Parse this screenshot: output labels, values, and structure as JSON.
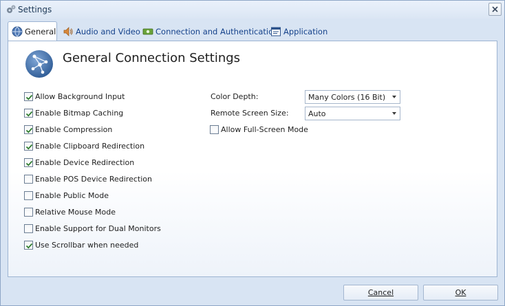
{
  "window": {
    "title": "Settings"
  },
  "tabs": [
    {
      "label": "General",
      "icon": "globe-icon",
      "active": true
    },
    {
      "label": "Audio and Video",
      "icon": "speaker-icon",
      "active": false
    },
    {
      "label": "Connection and Authentication",
      "icon": "network-icon",
      "active": false
    },
    {
      "label": "Application",
      "icon": "window-icon",
      "active": false
    }
  ],
  "panel": {
    "title": "General Connection Settings",
    "logo_icon": "network-globe-icon",
    "checkboxes": [
      {
        "label": "Allow Background Input",
        "checked": true
      },
      {
        "label": "Enable Bitmap Caching",
        "checked": true
      },
      {
        "label": "Enable Compression",
        "checked": true
      },
      {
        "label": "Enable Clipboard Redirection",
        "checked": true
      },
      {
        "label": "Enable Device Redirection",
        "checked": true
      },
      {
        "label": "Enable POS Device Redirection",
        "checked": false
      },
      {
        "label": "Enable Public Mode",
        "checked": false
      },
      {
        "label": "Relative Mouse Mode",
        "checked": false
      },
      {
        "label": "Enable Support for Dual Monitors",
        "checked": false
      },
      {
        "label": "Use Scrollbar when needed",
        "checked": true
      }
    ],
    "color_depth": {
      "label": "Color Depth:",
      "value": "Many Colors (16 Bit)"
    },
    "screen_size": {
      "label": "Remote Screen Size:",
      "value": "Auto"
    },
    "fullscreen": {
      "label": "Allow Full-Screen Mode",
      "checked": false
    }
  },
  "buttons": {
    "cancel": "Cancel",
    "ok": "OK"
  },
  "colors": {
    "window_bg": "#d8e4f3",
    "tab_text": "#15428b",
    "border": "#9db4d2",
    "check": "#2f7d2f"
  }
}
